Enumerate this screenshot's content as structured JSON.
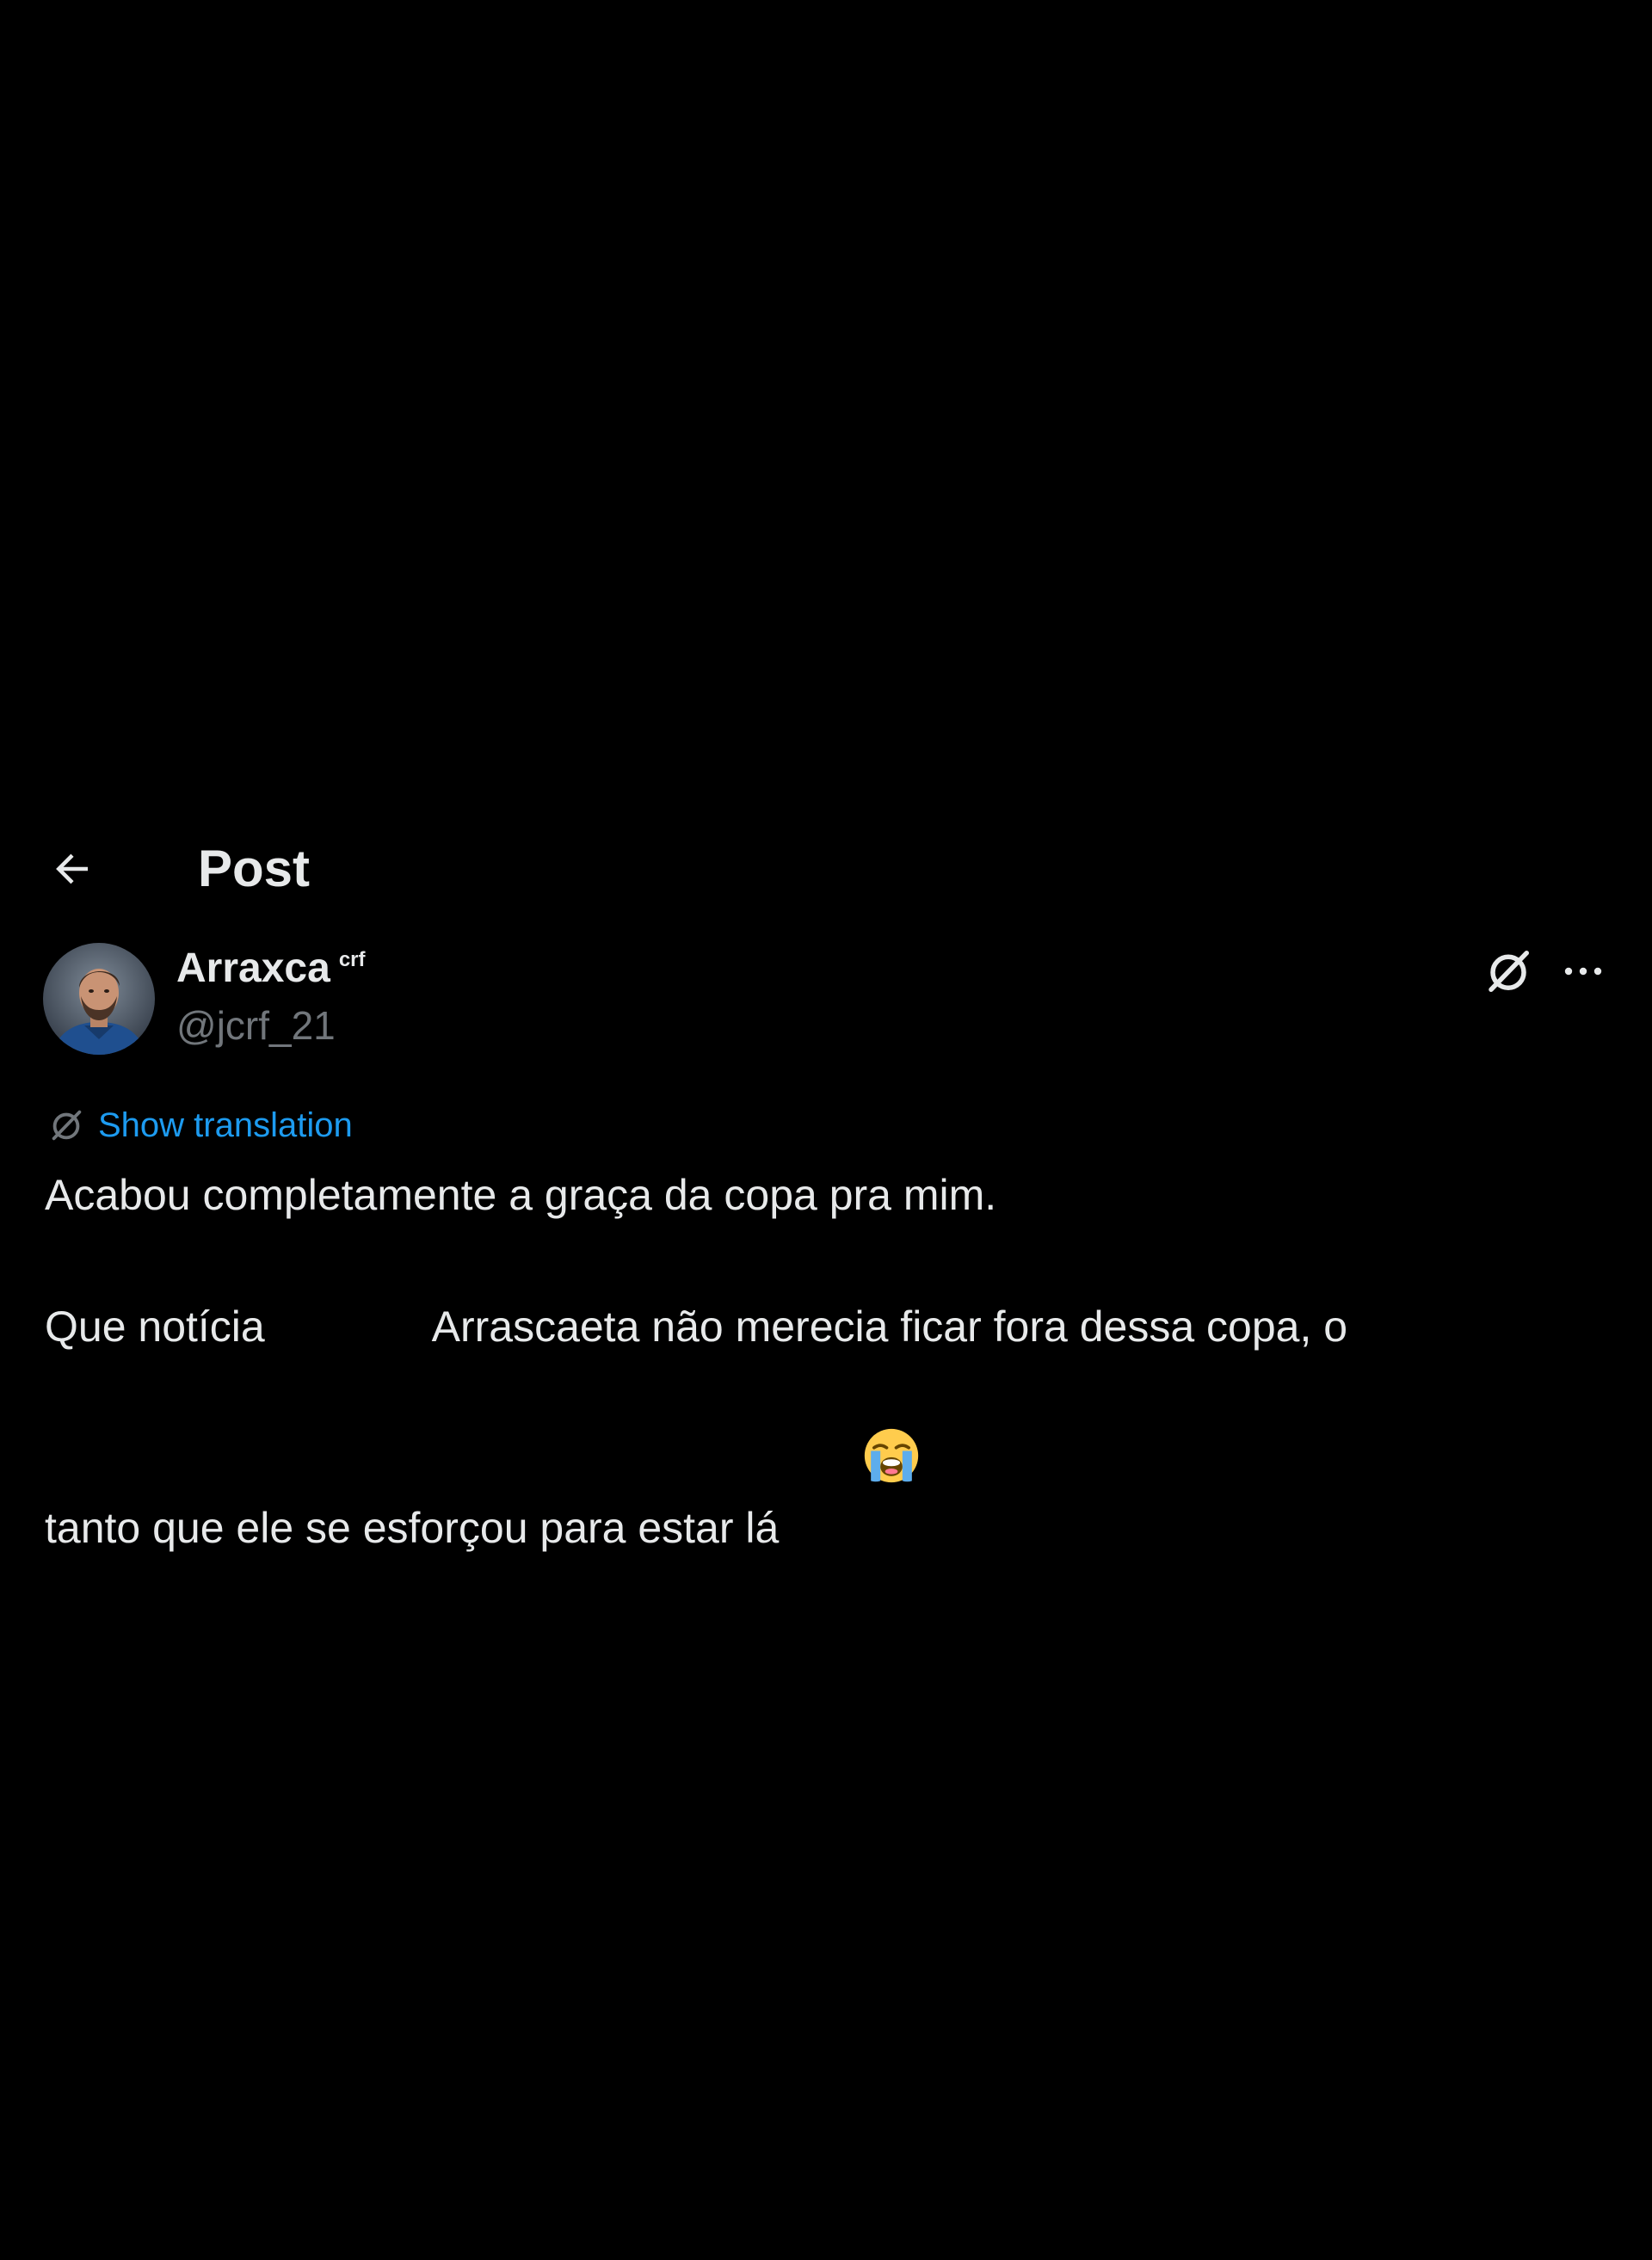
{
  "header": {
    "back_icon": "arrow-left-icon",
    "title": "Post"
  },
  "post": {
    "author": {
      "display_name": "Arraxca",
      "name_suffix": "crf",
      "handle": "@jcrf_21",
      "avatar": "profile-photo"
    },
    "actions": {
      "grok_icon": "grok-icon",
      "more_icon": "more-horizontal-icon"
    },
    "translation": {
      "icon": "translate-icon",
      "label": "Show translation"
    },
    "body": {
      "paragraph_1": "Acabou completamente a graça da copa pra mim.",
      "paragraph_2_line_1_start": "Que notícia ",
      "paragraph_2_line_1_end": "Arrascaeta não merecia ficar fora dessa copa, o",
      "paragraph_2_line_2": "tanto que ele se esforçou para estar lá ",
      "emoji": "loudly-crying-face-icon"
    }
  },
  "colors": {
    "background": "#000000",
    "primary_text": "#e7e9ea",
    "secondary_text": "#71767b",
    "link": "#1d9bf0"
  }
}
